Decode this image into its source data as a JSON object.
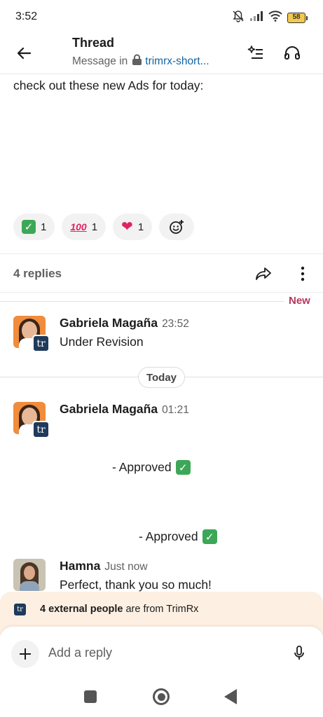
{
  "status_bar": {
    "time": "3:52",
    "battery": "58"
  },
  "header": {
    "title": "Thread",
    "subtitle_prefix": "Message in",
    "channel": "trimrx-short..."
  },
  "parent_message": {
    "text": "check out these new Ads for today:",
    "reactions": [
      {
        "emoji": "check-mark-emoji",
        "count": "1"
      },
      {
        "emoji": "hundred-points-emoji",
        "hundred_label": "100",
        "count": "1"
      },
      {
        "emoji": "red-heart-emoji",
        "count": "1"
      }
    ]
  },
  "replies": {
    "count_label": "4 replies",
    "new_label": "New",
    "today_label": "Today"
  },
  "messages": [
    {
      "name": "Gabriela Magaña",
      "time": "23:52",
      "text": "Under Revision"
    },
    {
      "name": "Gabriela Magaña",
      "time": "01:21",
      "text": ""
    },
    {
      "name": "Hamna",
      "time": "Just now",
      "text": "Perfect, thank you so much!"
    }
  ],
  "approved_lines": [
    "- Approved",
    "- Approved"
  ],
  "org_badge": "tr",
  "external_banner": {
    "bold": "4 external people",
    "rest": " are from TrimRx"
  },
  "composer": {
    "placeholder": "Add a reply"
  },
  "colors": {
    "link": "#1264a3",
    "new_accent": "#b5375e",
    "banner_bg": "#fdf0e2",
    "org_badge_bg": "#1f3a5a"
  }
}
